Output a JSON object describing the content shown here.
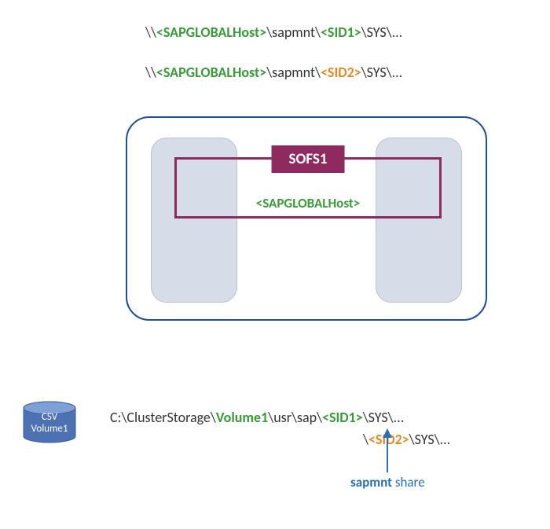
{
  "paths": {
    "line1": {
      "p1": "\\\\",
      "host": "<SAPGLOBALHost>",
      "p2": "\\sapmnt\\",
      "sid": "<SID1>",
      "p3": "\\SYS\\..."
    },
    "line2": {
      "p1": "\\\\",
      "host": "<SAPGLOBALHost>",
      "p2": "\\sapmnt\\",
      "sid": "<SID2>",
      "p3": "\\SYS\\..."
    }
  },
  "cluster": {
    "sofs_label": "SOFS1",
    "sofs_host": "<SAPGLOBALHost>"
  },
  "csv_disk": {
    "line1": "CSV",
    "line2": "Volume1"
  },
  "local_path": {
    "line1": {
      "p1": "C:\\ClusterStorage\\",
      "vol": "Volume1",
      "p2": "\\usr\\sap\\",
      "sid": "<SID1>",
      "p3": "\\SYS\\..."
    },
    "line2": {
      "p1": "\\",
      "sid": "<SID2>",
      "p2": "\\SYS\\..."
    }
  },
  "share_label": {
    "bold": "sapmnt",
    "rest": " share"
  }
}
